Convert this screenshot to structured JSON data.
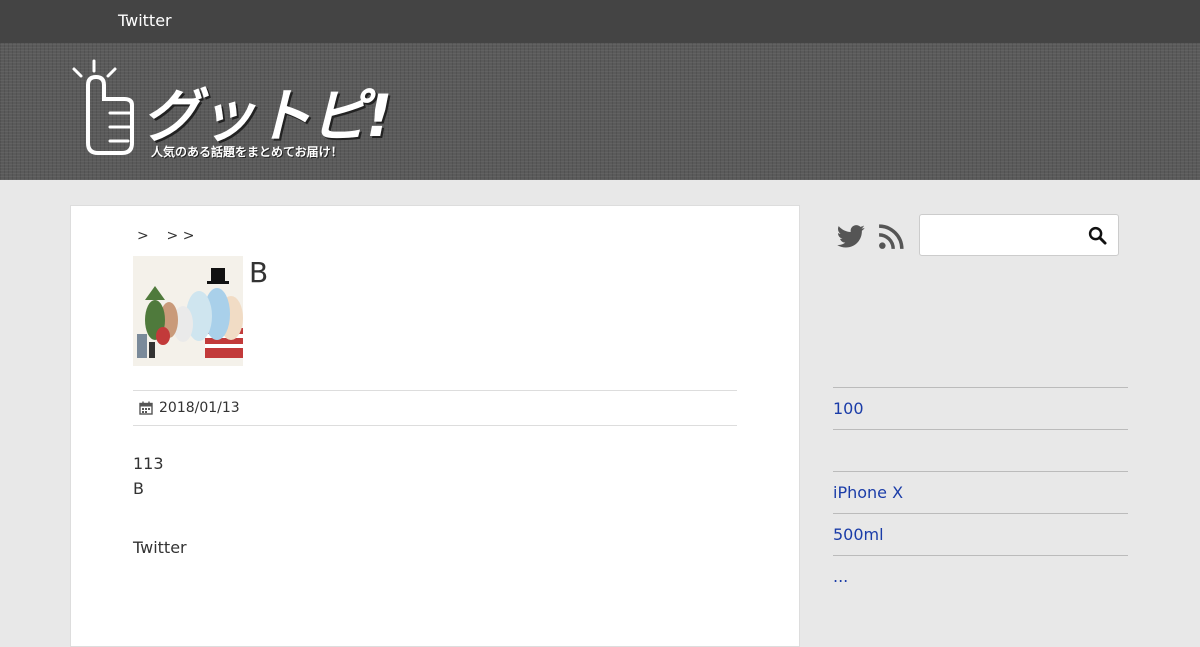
{
  "topnav": {
    "twitter_label": "Twitter"
  },
  "header": {
    "logo_text": "グットピ!",
    "tagline": "人気のある話題をまとめてお届け！"
  },
  "breadcrumb": {
    "text": ">    > >"
  },
  "post": {
    "title": "B",
    "date": "2018/01/13",
    "lines": [
      "113",
      "B"
    ],
    "share_label": "Twitter",
    "thumbnail_icon": "moomin-characters-image"
  },
  "sidebar": {
    "social_icons": [
      "twitter-icon",
      "rss-icon"
    ],
    "search_placeholder": "",
    "links": [
      "100",
      "",
      "iPhone X",
      "500ml",
      "..."
    ]
  },
  "colors": {
    "topnav_bg": "#444444",
    "header_bg": "#5a5a5a",
    "link": "#1a3ca8",
    "page_bg": "#e8e8e8"
  }
}
